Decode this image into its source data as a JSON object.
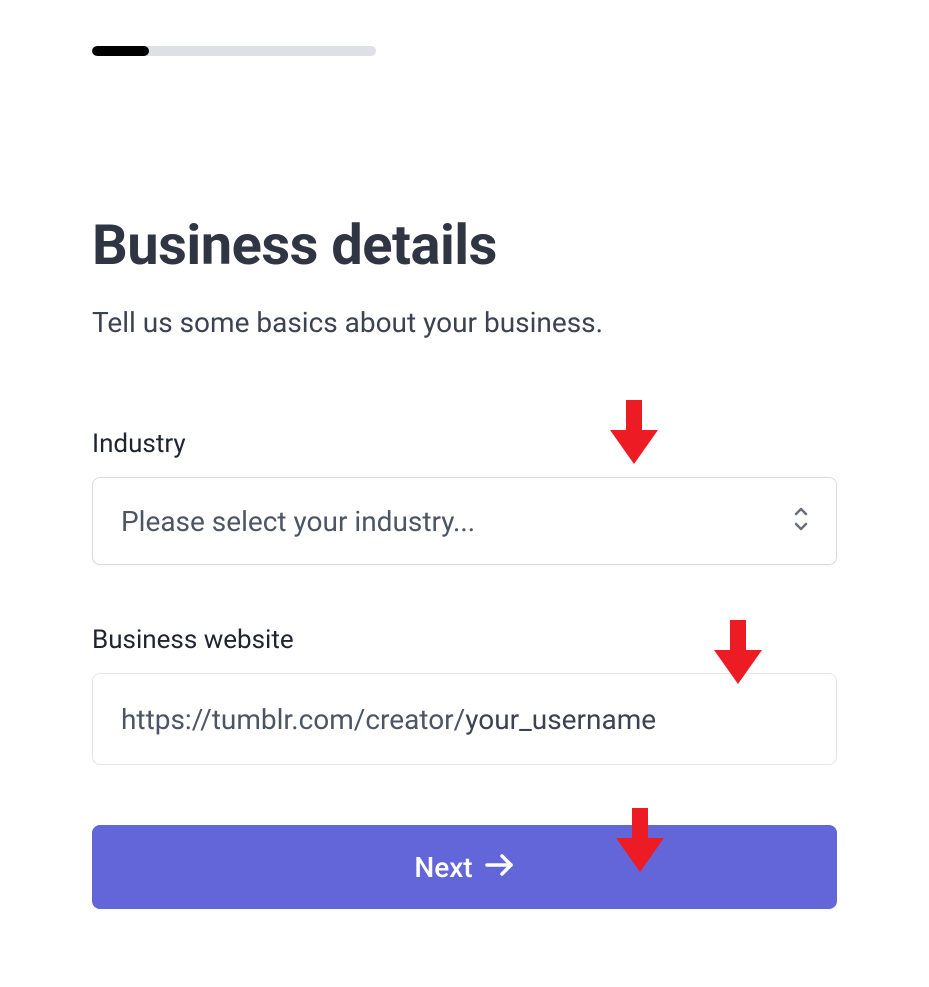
{
  "progress": {
    "percent": 20
  },
  "heading": {
    "title": "Business details",
    "subtitle": "Tell us some basics about your business."
  },
  "form": {
    "industry": {
      "label": "Industry",
      "placeholder": "Please select your industry..."
    },
    "website": {
      "label": "Business website",
      "value_prefix": "https://tumblr.com/creator/",
      "value_suffix": "your_username"
    },
    "next_button": "Next"
  },
  "annotations": {
    "arrow_color": "#ed1c24"
  }
}
